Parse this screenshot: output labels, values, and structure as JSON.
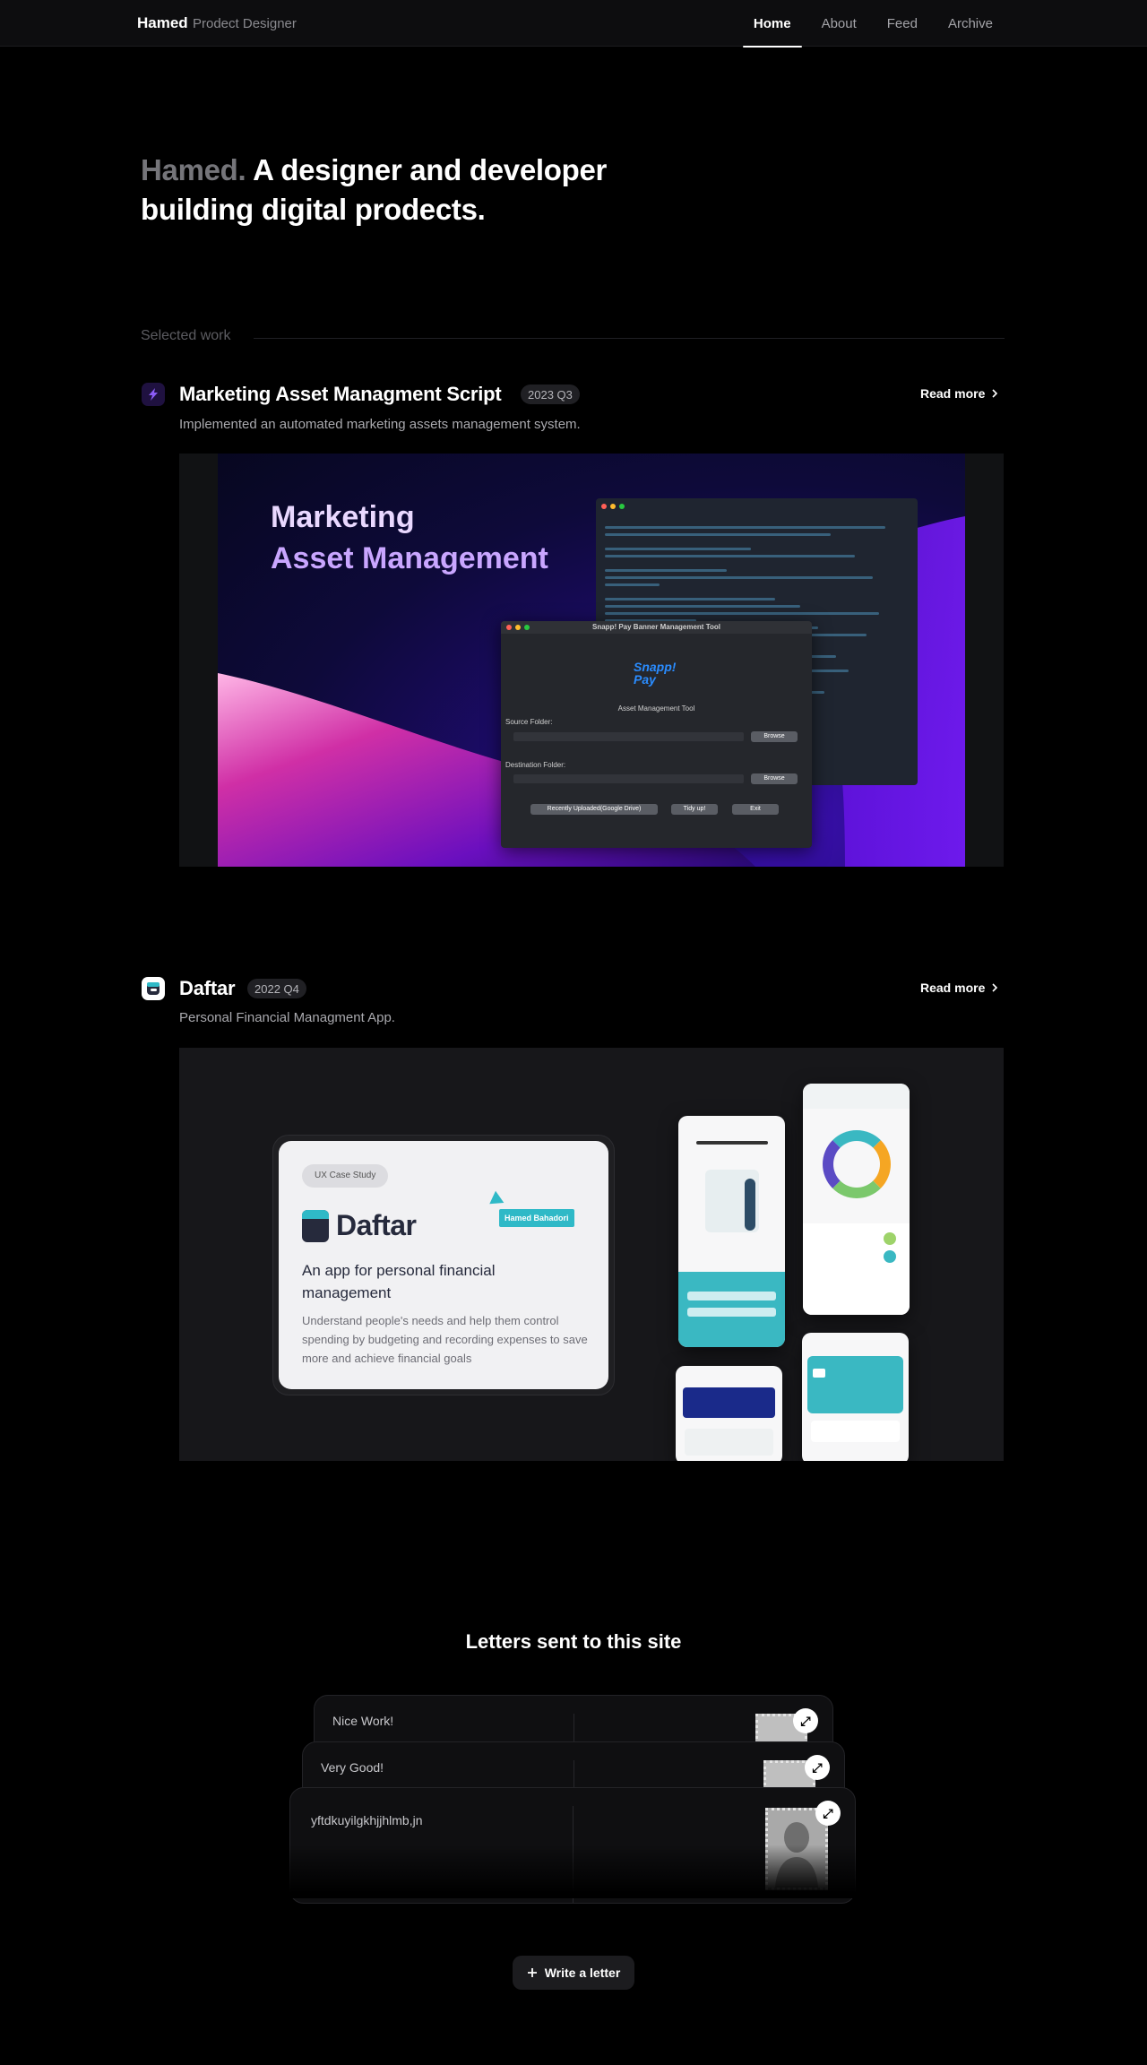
{
  "nav": {
    "brand": "Hamed",
    "subtitle": "Prodect Designer",
    "links": [
      {
        "label": "Home",
        "active": true
      },
      {
        "label": "About",
        "active": false
      },
      {
        "label": "Feed",
        "active": false
      },
      {
        "label": "Archive",
        "active": false
      }
    ]
  },
  "hero": {
    "name": "Hamed.",
    "tagline": "A designer and developer building digital prodects."
  },
  "selected_work": {
    "heading": "Selected work",
    "projects": [
      {
        "title": "Marketing Asset Managment Script",
        "badge": "2023 Q3",
        "description": "Implemented an automated marketing assets management system.",
        "read_more": "Read more",
        "shot": {
          "headline_line1": "Marketing",
          "headline_line2": "Asset Management",
          "window_title": "Snapp! Pay Banner Management Tool",
          "logo_line1": "Snapp!",
          "logo_line2": "Pay",
          "app_subtitle": "Asset Management Tool",
          "source_label": "Source Folder:",
          "destination_label": "Destination Folder:",
          "browse": "Browse",
          "btn_recent": "Recently Uploaded(Google Drive)",
          "btn_tidy": "Tidy up!",
          "btn_exit": "Exit"
        }
      },
      {
        "title": "Daftar",
        "badge": "2022 Q4",
        "description": "Personal Financial Managment App.",
        "read_more": "Read more",
        "shot": {
          "chip": "UX Case Study",
          "logo": "Daftar",
          "name_tag": "Hamed Bahadori",
          "heading": "An app for personal financial management",
          "body": "Understand people's needs and help them control spending by budgeting and recording expenses to save more and achieve financial goals"
        }
      }
    ]
  },
  "letters": {
    "title": "Letters sent to this site",
    "items": [
      {
        "text": "Nice Work!"
      },
      {
        "text": "Very Good!"
      },
      {
        "text": "yftdkuyilgkhjjhlmb,jn"
      }
    ],
    "write_button": "Write a letter"
  },
  "colors": {
    "background": "#000000",
    "daftar_accent": "#2fb9c7",
    "snapp_blue": "#2a8cff"
  }
}
